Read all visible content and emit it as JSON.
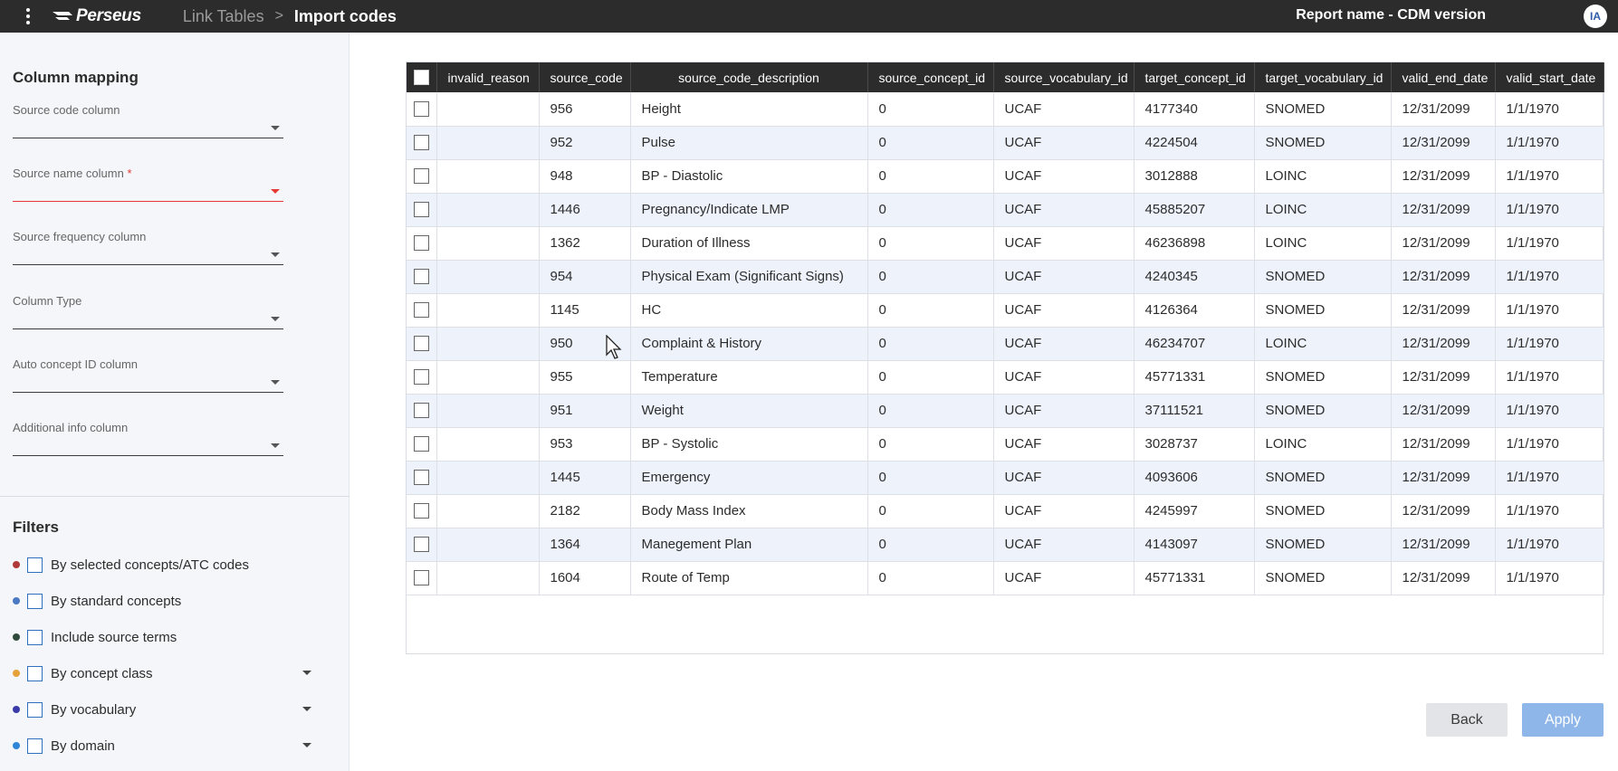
{
  "header": {
    "app_name": "Perseus",
    "breadcrumb_parent": "Link Tables",
    "breadcrumb_separator": ">",
    "breadcrumb_current": "Import codes",
    "report_name": "Report name - CDM version",
    "avatar_initials": "IA"
  },
  "sidebar": {
    "column_mapping_title": "Column mapping",
    "fields": [
      {
        "label": "Source code column",
        "required": false,
        "value": ""
      },
      {
        "label": "Source name column",
        "required": true,
        "value": ""
      },
      {
        "label": "Source frequency column",
        "required": false,
        "value": ""
      },
      {
        "label": "Column Type",
        "required": false,
        "value": ""
      },
      {
        "label": "Auto concept ID column",
        "required": false,
        "value": ""
      },
      {
        "label": "Additional info column",
        "required": false,
        "value": ""
      }
    ],
    "required_marker": "*",
    "filters_title": "Filters",
    "filters": [
      {
        "label": "By selected concepts/ATC codes",
        "color": "#b03a3a",
        "has_dropdown": false
      },
      {
        "label": "By standard concepts",
        "color": "#4a78c2",
        "has_dropdown": false
      },
      {
        "label": "Include source terms",
        "color": "#2f4a3a",
        "has_dropdown": false
      },
      {
        "label": "By concept class",
        "color": "#e5a23a",
        "has_dropdown": true
      },
      {
        "label": "By vocabulary",
        "color": "#3a3aa8",
        "has_dropdown": true
      },
      {
        "label": "By domain",
        "color": "#2f86d6",
        "has_dropdown": true
      }
    ]
  },
  "table": {
    "columns": [
      "invalid_reason",
      "source_code",
      "source_code_description",
      "source_concept_id",
      "source_vocabulary_id",
      "target_concept_id",
      "target_vocabulary_id",
      "valid_end_date",
      "valid_start_date"
    ],
    "rows": [
      [
        "",
        "956",
        "Height",
        "0",
        "UCAF",
        "4177340",
        "SNOMED",
        "12/31/2099",
        "1/1/1970"
      ],
      [
        "",
        "952",
        "Pulse",
        "0",
        "UCAF",
        "4224504",
        "SNOMED",
        "12/31/2099",
        "1/1/1970"
      ],
      [
        "",
        "948",
        "BP - Diastolic",
        "0",
        "UCAF",
        "3012888",
        "LOINC",
        "12/31/2099",
        "1/1/1970"
      ],
      [
        "",
        "1446",
        "Pregnancy/Indicate LMP",
        "0",
        "UCAF",
        "45885207",
        "LOINC",
        "12/31/2099",
        "1/1/1970"
      ],
      [
        "",
        "1362",
        "Duration of Illness",
        "0",
        "UCAF",
        "46236898",
        "LOINC",
        "12/31/2099",
        "1/1/1970"
      ],
      [
        "",
        "954",
        "Physical Exam (Significant Signs)",
        "0",
        "UCAF",
        "4240345",
        "SNOMED",
        "12/31/2099",
        "1/1/1970"
      ],
      [
        "",
        "1145",
        "HC",
        "0",
        "UCAF",
        "4126364",
        "SNOMED",
        "12/31/2099",
        "1/1/1970"
      ],
      [
        "",
        "950",
        "Complaint & History",
        "0",
        "UCAF",
        "46234707",
        "LOINC",
        "12/31/2099",
        "1/1/1970"
      ],
      [
        "",
        "955",
        "Temperature",
        "0",
        "UCAF",
        "45771331",
        "SNOMED",
        "12/31/2099",
        "1/1/1970"
      ],
      [
        "",
        "951",
        "Weight",
        "0",
        "UCAF",
        "37111521",
        "SNOMED",
        "12/31/2099",
        "1/1/1970"
      ],
      [
        "",
        "953",
        "BP - Systolic",
        "0",
        "UCAF",
        "3028737",
        "LOINC",
        "12/31/2099",
        "1/1/1970"
      ],
      [
        "",
        "1445",
        "Emergency",
        "0",
        "UCAF",
        "4093606",
        "SNOMED",
        "12/31/2099",
        "1/1/1970"
      ],
      [
        "",
        "2182",
        "Body Mass Index",
        "0",
        "UCAF",
        "4245997",
        "SNOMED",
        "12/31/2099",
        "1/1/1970"
      ],
      [
        "",
        "1364",
        "Manegement Plan",
        "0",
        "UCAF",
        "4143097",
        "SNOMED",
        "12/31/2099",
        "1/1/1970"
      ],
      [
        "",
        "1604",
        "Route of Temp",
        "0",
        "UCAF",
        "45771331",
        "SNOMED",
        "12/31/2099",
        "1/1/1970"
      ]
    ]
  },
  "actions": {
    "back_label": "Back",
    "apply_label": "Apply"
  }
}
